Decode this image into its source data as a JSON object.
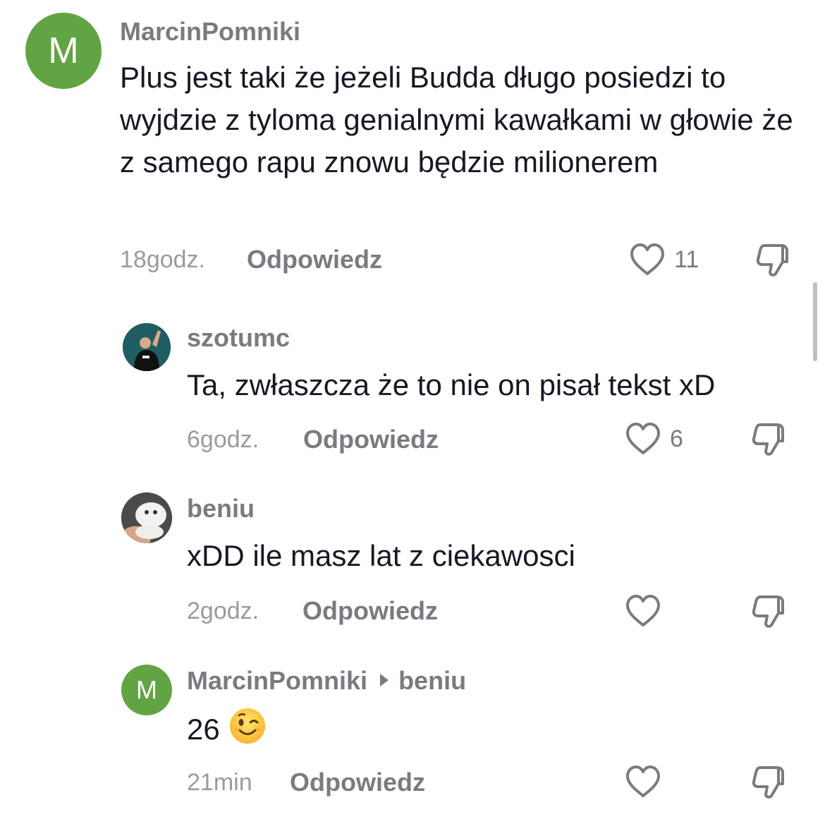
{
  "comments": [
    {
      "avatar_letter": "M",
      "username": "MarcinPomniki",
      "text": "Plus jest taki że jeżeli Budda długo posiedzi to wyjdzie z tyloma genialnymi kawałkami w głowie że z samego rapu znowu będzie milionerem",
      "time": "18godz.",
      "reply_label": "Odpowiedz",
      "likes": "11"
    },
    {
      "username": "szotumc",
      "text": "Ta, zwłaszcza że to nie on pisał tekst xD",
      "time": "6godz.",
      "reply_label": "Odpowiedz",
      "likes": "6"
    },
    {
      "username": "beniu",
      "text": "xDD ile masz lat z ciekawosci",
      "time": "2godz.",
      "reply_label": "Odpowiedz",
      "likes": ""
    },
    {
      "avatar_letter": "M",
      "username": "MarcinPomniki",
      "reply_to": "beniu",
      "text": "26",
      "emoji": "winking-face",
      "time": "21min",
      "reply_label": "Odpowiedz",
      "likes": ""
    }
  ],
  "colors": {
    "avatar_green": "#62a444",
    "text_primary": "#161823",
    "text_secondary": "#7a7b80",
    "text_time": "#9a9ba0",
    "icon_stroke": "#7a7b80"
  }
}
